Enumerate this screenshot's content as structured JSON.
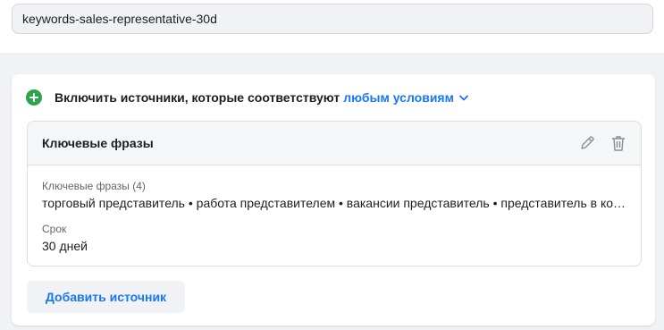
{
  "audience_name": "keywords-sales-representative-30d",
  "include": {
    "prefix": "Включить источники, которые соответствуют",
    "condition_link": "любым условиям"
  },
  "source": {
    "title": "Ключевые фразы",
    "keywords_label": "Ключевые фразы (4)",
    "keywords_value": "торговый представитель • работа представителем • вакансии представитель • представитель в компанию",
    "period_label": "Срок",
    "period_value": "30 дней"
  },
  "add_source_label": "Добавить источник",
  "colors": {
    "accent": "#1877f2",
    "add_icon": "#31a24c",
    "panel_bg": "#f0f2f5"
  },
  "icons": [
    "plus-circle-icon",
    "chevron-down-icon",
    "pencil-icon",
    "trash-icon"
  ]
}
